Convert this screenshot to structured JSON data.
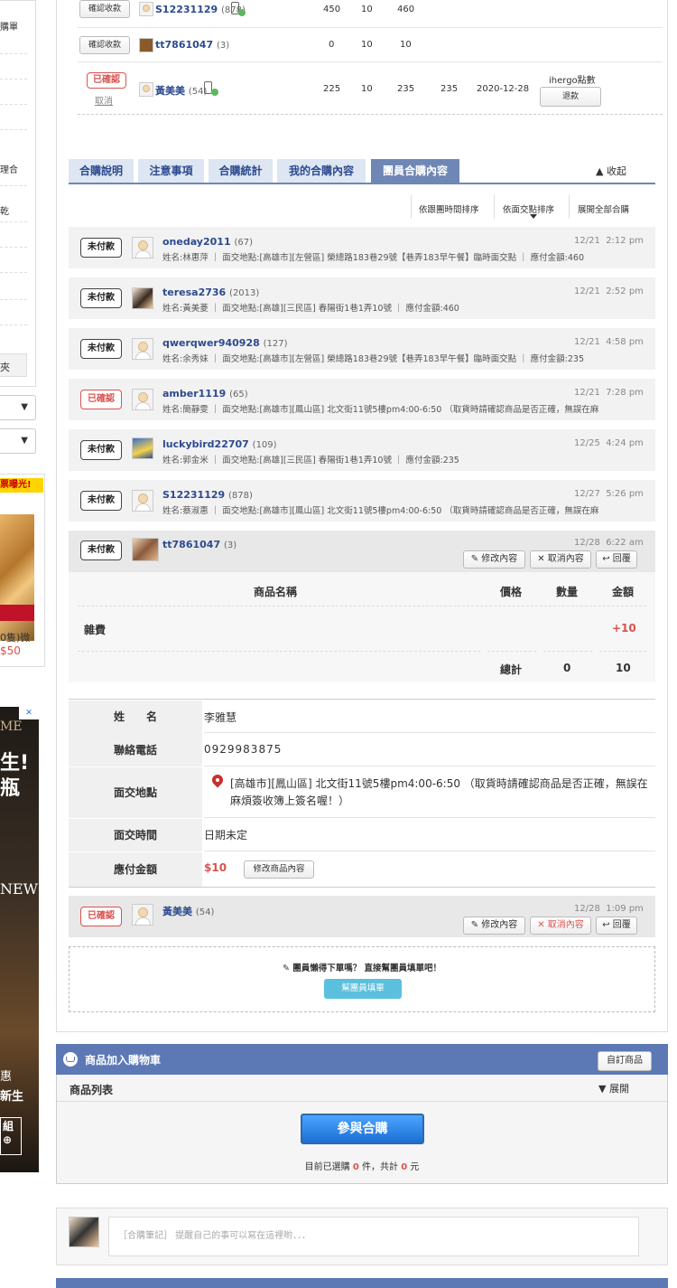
{
  "sidebar": {
    "frag_top": "購單",
    "frag_mid": "理合",
    "frag_low": "乾",
    "frag_btn": "夾",
    "select_arrow": "▼"
  },
  "ads": {
    "promo_banner": "票曝光!",
    "product_caption": "0隻)微",
    "product_price": "$50",
    "ad_line1": "ME",
    "ad_line2": "生!",
    "ad_line3": "瓶",
    "ad_line4": "NEW",
    "ad_line5": "惠",
    "ad_line6": "新生",
    "ad_btn_l1": "組",
    "ad_btn_l2": "⊕",
    "ad_close": "✕"
  },
  "order_rows": [
    {
      "action": "確認收款",
      "user": "S12231129",
      "count": "(878)",
      "v1": "450",
      "v2": "10",
      "v3": "460",
      "v4": "",
      "date": ""
    },
    {
      "action": "確認收款",
      "user": "tt7861047",
      "count": "(3)",
      "v1": "0",
      "v2": "10",
      "v3": "10",
      "v4": "",
      "date": ""
    },
    {
      "action": "已確認",
      "cancel": "取消",
      "user": "黃美美",
      "count": "(54)",
      "v1": "225",
      "v2": "10",
      "v3": "235",
      "v4": "235",
      "date": "2020-12-28",
      "note": "ihergo點數",
      "refund": "退款"
    }
  ],
  "tabs": [
    {
      "label": "合購說明"
    },
    {
      "label": "注意事項"
    },
    {
      "label": "合購統計"
    },
    {
      "label": "我的合購內容"
    },
    {
      "label": "團員合購內容"
    }
  ],
  "collapse_label": "▲ 收起",
  "sort": {
    "by_time": "依跟團時間排序",
    "by_place": "依面交點排序",
    "expand_all": "展開全部合購"
  },
  "members": [
    {
      "status": "未付款",
      "user": "oneday2011",
      "count": "(67)",
      "date": "12/21",
      "time": "2:12 pm",
      "detail": "姓名:林惠萍 ｜ 面交地點:[高雄市][左營區] 榮總路183巷29號【巷弄183早午餐】臨時面交點 ｜ 應付金額:460"
    },
    {
      "status": "未付款",
      "user": "teresa2736",
      "count": "(2013)",
      "date": "12/21",
      "time": "2:52 pm",
      "detail": "姓名:黃美菱 ｜ 面交地點:[高雄][三民區] 春陽街1巷1弄10號 ｜ 應付金額:460"
    },
    {
      "status": "未付款",
      "user": "qwerqwer940928",
      "count": "(127)",
      "date": "12/21",
      "time": "4:58 pm",
      "detail": "姓名:余秀妹 ｜ 面交地點:[高雄市][左營區] 榮總路183巷29號【巷弄183早午餐】臨時面交點 ｜ 應付金額:235"
    },
    {
      "status": "已確認",
      "user": "amber1119",
      "count": "(65)",
      "date": "12/21",
      "time": "7:28 pm",
      "detail": "姓名:簡靜雯 ｜ 面交地點:[高雄市][鳳山區] 北文街11號5樓pm4:00-6:50 （取貨時請確認商品是否正確，無誤在麻"
    },
    {
      "status": "未付款",
      "user": "luckybird22707",
      "count": "(109)",
      "date": "12/25",
      "time": "4:24 pm",
      "detail": "姓名:郭金米 ｜ 面交地點:[高雄][三民區] 春陽街1巷1弄10號 ｜ 應付金額:235"
    },
    {
      "status": "未付款",
      "user": "S12231129",
      "count": "(878)",
      "date": "12/27",
      "time": "5:26 pm",
      "detail": "姓名:蔡淑惠 ｜ 面交地點:[高雄市][鳳山區] 北文街11號5樓pm4:00-6:50 （取貨時請確認商品是否正確，無誤在麻"
    }
  ],
  "expanded": {
    "status": "未付款",
    "user": "tt7861047",
    "count": "(3)",
    "date": "12/28",
    "time": "6:22 am",
    "edit": "修改內容",
    "cancel": "取消內容",
    "reply": "回覆",
    "table": {
      "h_name": "商品名稱",
      "h_price": "價格",
      "h_qty": "數量",
      "h_amount": "金額",
      "item_name": "雜費",
      "item_amount": "+10",
      "total_label": "總計",
      "total_qty": "0",
      "total_amount": "10"
    },
    "form": {
      "name_label": "姓　　名",
      "name": "李雅慧",
      "phone_label": "聯絡電話",
      "phone": "0929983875",
      "place_label": "面交地點",
      "place": "[高雄市][鳳山區] 北文街11號5樓pm4:00-6:50 （取貨時請確認商品是否正確，無誤在麻煩簽收簿上簽名喔！）",
      "time_label": "面交時間",
      "time": "日期未定",
      "pay_label": "應付金額",
      "pay": "$10",
      "modify": "修改商品內容"
    }
  },
  "last_member": {
    "status": "已確認",
    "user": "黃美美",
    "count": "(54)",
    "date": "12/28",
    "time": "1:09 pm",
    "edit": "修改內容",
    "cancel": "取消內容",
    "reply": "回覆"
  },
  "fill_box": {
    "prompt": "團員懶得下單嗎？ 直接幫團員填單吧！",
    "button": "幫團員填單"
  },
  "cart": {
    "title": "商品加入購物車",
    "custom": "自訂商品",
    "list_label": "商品列表",
    "expand": "▼ 展開",
    "join": "參與合購",
    "sel_prefix": "目前已選購",
    "sel_count": "0",
    "sel_mid": "件，共計",
    "sel_total": "0",
    "sel_suffix": "元"
  },
  "note": {
    "placeholder": "［合購筆記］ 提醒自己的事可以寫在這裡喲．．．"
  }
}
